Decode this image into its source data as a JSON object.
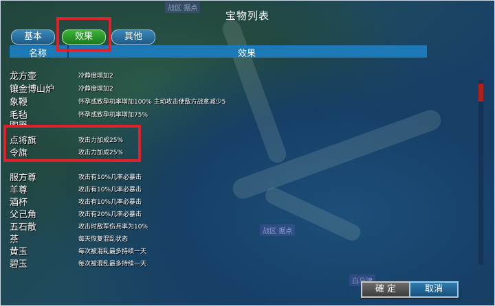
{
  "window": {
    "title": "宝物列表"
  },
  "map": {
    "labels": [
      "战区 据点",
      "战区 据点",
      "白马津"
    ]
  },
  "tabs": [
    {
      "label": "基本",
      "active": false
    },
    {
      "label": "效果",
      "active": true
    },
    {
      "label": "其他",
      "active": false
    }
  ],
  "table": {
    "col_name": "名称",
    "col_effect": "效果",
    "rows": [
      {
        "name": "龙方壶",
        "effect": "冷静度增加2"
      },
      {
        "name": "镶金博山炉",
        "effect": "冷静度增加2"
      },
      {
        "name": "象鞭",
        "effect": "怀孕或致孕机率增加100%   主动攻击使敌方战意减少5"
      },
      {
        "name": "毛毡",
        "effect": "怀孕或致孕机率增加75%"
      },
      {
        "name": "陶器",
        "effect": ""
      },
      {
        "name": "点将旗",
        "effect": "攻击力加成25%"
      },
      {
        "name": "令旗",
        "effect": "攻击力加成25%"
      },
      {
        "name": "",
        "effect": ""
      },
      {
        "name": "服方尊",
        "effect": "攻击有10%几率必暴击"
      },
      {
        "name": "羊尊",
        "effect": "攻击有10%几率必暴击"
      },
      {
        "name": "酒杯",
        "effect": "攻击有10%几率必暴击"
      },
      {
        "name": "父己角",
        "effect": "攻击有20%几率必暴击"
      },
      {
        "name": "五石散",
        "effect": "攻击时敌军伤兵率为10%"
      },
      {
        "name": "茶",
        "effect": "每天恢复混乱状态"
      },
      {
        "name": "黄玉",
        "effect": "每次被混乱最多持续一天"
      },
      {
        "name": "碧玉",
        "effect": "每次被混乱最多持续一天"
      }
    ]
  },
  "buttons": {
    "ok": "確 定",
    "cancel": "取消"
  },
  "colors": {
    "highlight": "#e0202a",
    "active_tab": "#2a9a28",
    "header": "#1c79b6",
    "scroll_thumb": "#b2201a"
  }
}
